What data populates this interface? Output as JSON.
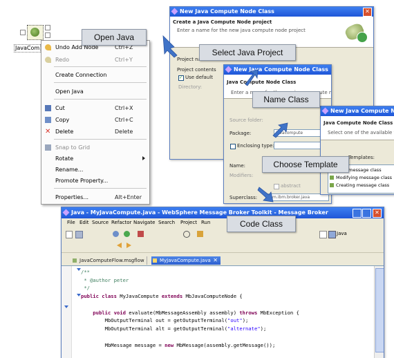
{
  "canvas_node": {
    "label": "JavaCom"
  },
  "context_menu": {
    "items": [
      {
        "label": "Undo Add Node",
        "shortcut": "Ctrl+Z",
        "disabled": false,
        "icon": "undo-icon"
      },
      {
        "label": "Redo",
        "shortcut": "Ctrl+Y",
        "disabled": true,
        "icon": "redo-icon"
      },
      {
        "label": "Create Connection",
        "shortcut": "",
        "disabled": false,
        "icon": ""
      },
      {
        "label": "Open Java",
        "shortcut": "",
        "disabled": false,
        "icon": ""
      },
      {
        "label": "Cut",
        "shortcut": "Ctrl+X",
        "disabled": false,
        "icon": "cut-icon"
      },
      {
        "label": "Copy",
        "shortcut": "Ctrl+C",
        "disabled": false,
        "icon": "copy-icon"
      },
      {
        "label": "Delete",
        "shortcut": "Delete",
        "disabled": false,
        "icon": "delete-icon"
      },
      {
        "label": "Snap to Grid",
        "shortcut": "",
        "disabled": true,
        "icon": "grid-icon"
      },
      {
        "label": "Rotate",
        "shortcut": "",
        "disabled": false,
        "icon": "",
        "submenu": true
      },
      {
        "label": "Rename...",
        "shortcut": "",
        "disabled": false,
        "icon": ""
      },
      {
        "label": "Promote Property...",
        "shortcut": "",
        "disabled": false,
        "icon": ""
      },
      {
        "label": "Properties...",
        "shortcut": "Alt+Enter",
        "disabled": false,
        "icon": ""
      }
    ]
  },
  "callouts": {
    "open_java": "Open Java",
    "select_project": "Select Java Project",
    "name_class": "Name Class",
    "choose_template": "Choose Template",
    "code_class": "Code Class"
  },
  "wizard1": {
    "title": "New Java Compute Node Class",
    "heading": "Create a Java Compute Node project",
    "subheading": "Enter a name for the new java compute node project",
    "project_name_label": "Project name:",
    "project_contents_label": "Project contents",
    "use_default": "Use default",
    "directory_label": "Directory:"
  },
  "wizard2": {
    "title": "New Java Compute Node Class",
    "heading": "Java Compute Node Class",
    "subheading": "Enter a name for the new java compute node class",
    "source_folder_label": "Source folder:",
    "package_label": "Package:",
    "package_value": "javacompute",
    "enclosing_label": "Enclosing type:",
    "name_label": "Name:",
    "modifiers_label": "Modifiers:",
    "abstract_label": "abstract",
    "superclass_label": "Superclass:",
    "superclass_value": "com.ibm.broker.java"
  },
  "wizard3": {
    "title": "New Java Compute Node",
    "heading": "Java Compute Node Class",
    "subheading": "Select one of the available templates",
    "templates_label": "Templates:",
    "templates": [
      "Filter message class",
      "Modifying message class",
      "Creating message class"
    ]
  },
  "ide": {
    "title": "Java - MyJavaCompute.java - WebSphere Message Broker Toolkit - Message Broker",
    "menu": [
      "File",
      "Edit",
      "Source",
      "Refactor",
      "Navigate",
      "Search",
      "Project",
      "Run"
    ],
    "perspective": "Java",
    "tabs": [
      {
        "label": "JavaComputeFlow.msgflow",
        "active": false
      },
      {
        "label": "MyJavaCompute.java",
        "active": true
      }
    ],
    "code_lines": [
      {
        "segments": [
          {
            "t": "/**",
            "c": "cmt"
          }
        ]
      },
      {
        "segments": [
          {
            "t": " * @author peter",
            "c": "cmt"
          }
        ]
      },
      {
        "segments": [
          {
            "t": " */",
            "c": "cmt"
          }
        ]
      },
      {
        "segments": [
          {
            "t": "public class ",
            "c": "kw"
          },
          {
            "t": "MyJavaCompute ",
            "c": ""
          },
          {
            "t": "extends ",
            "c": "kw"
          },
          {
            "t": "MbJavaComputeNode {",
            "c": ""
          }
        ]
      },
      {
        "segments": [
          {
            "t": "",
            "c": ""
          }
        ]
      },
      {
        "segments": [
          {
            "t": "    public void ",
            "c": "kw"
          },
          {
            "t": "evaluate(MbMessageAssembly assembly) ",
            "c": ""
          },
          {
            "t": "throws ",
            "c": "kw"
          },
          {
            "t": "MbException {",
            "c": ""
          }
        ]
      },
      {
        "segments": [
          {
            "t": "        MbOutputTerminal out = getOutputTerminal(",
            "c": ""
          },
          {
            "t": "\"out\"",
            "c": "str"
          },
          {
            "t": ");",
            "c": ""
          }
        ]
      },
      {
        "segments": [
          {
            "t": "        MbOutputTerminal alt = getOutputTerminal(",
            "c": ""
          },
          {
            "t": "\"alternate\"",
            "c": "str"
          },
          {
            "t": ");",
            "c": ""
          }
        ]
      },
      {
        "segments": [
          {
            "t": "",
            "c": ""
          }
        ]
      },
      {
        "segments": [
          {
            "t": "        MbMessage message = ",
            "c": ""
          },
          {
            "t": "new ",
            "c": "kw"
          },
          {
            "t": "MbMessage(assembly.getMessage());",
            "c": ""
          }
        ]
      }
    ]
  },
  "colors": {
    "callout_bg": "#d9dde3",
    "xp_title": "#2a63dc",
    "arrow": "#3f73c8"
  }
}
